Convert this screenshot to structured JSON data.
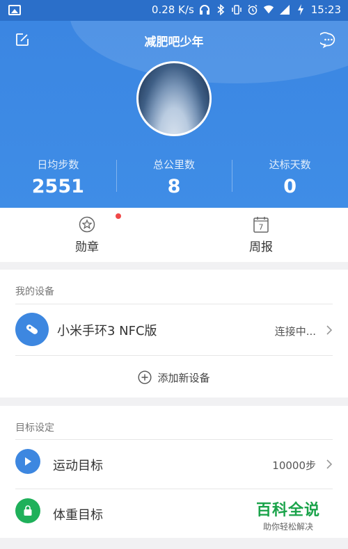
{
  "status_bar": {
    "net_speed": "0.28 K/s",
    "time": "15:23",
    "icons": [
      "gallery-icon",
      "headphones-icon",
      "bluetooth-icon",
      "vibrate-icon",
      "alarm-icon",
      "wifi-icon",
      "signal-icon",
      "charging-icon"
    ]
  },
  "header": {
    "title": "减肥吧少年",
    "left_icon": "edit-icon",
    "right_icon": "chat-icon",
    "accent": "#3b86e2"
  },
  "stats": [
    {
      "label": "日均步数",
      "value": "2551"
    },
    {
      "label": "总公里数",
      "value": "8"
    },
    {
      "label": "达标天数",
      "value": "0"
    }
  ],
  "quick": {
    "medal_label": "勋章",
    "weekly_label": "周报",
    "calendar_day": "7"
  },
  "devices": {
    "section_title": "我的设备",
    "device_name": "小米手环3 NFC版",
    "device_status": "连接中...",
    "add_label": "添加新设备"
  },
  "goals": {
    "section_title": "目标设定",
    "items": [
      {
        "label": "运动目标",
        "value": "10000步",
        "icon": "flag-icon",
        "color": "#3d87e0"
      },
      {
        "label": "体重目标",
        "value": "",
        "icon": "weight-icon",
        "color": "#1fb05a"
      }
    ]
  },
  "watermark": {
    "main": "百科全说",
    "sub": "助你轻松解决"
  }
}
